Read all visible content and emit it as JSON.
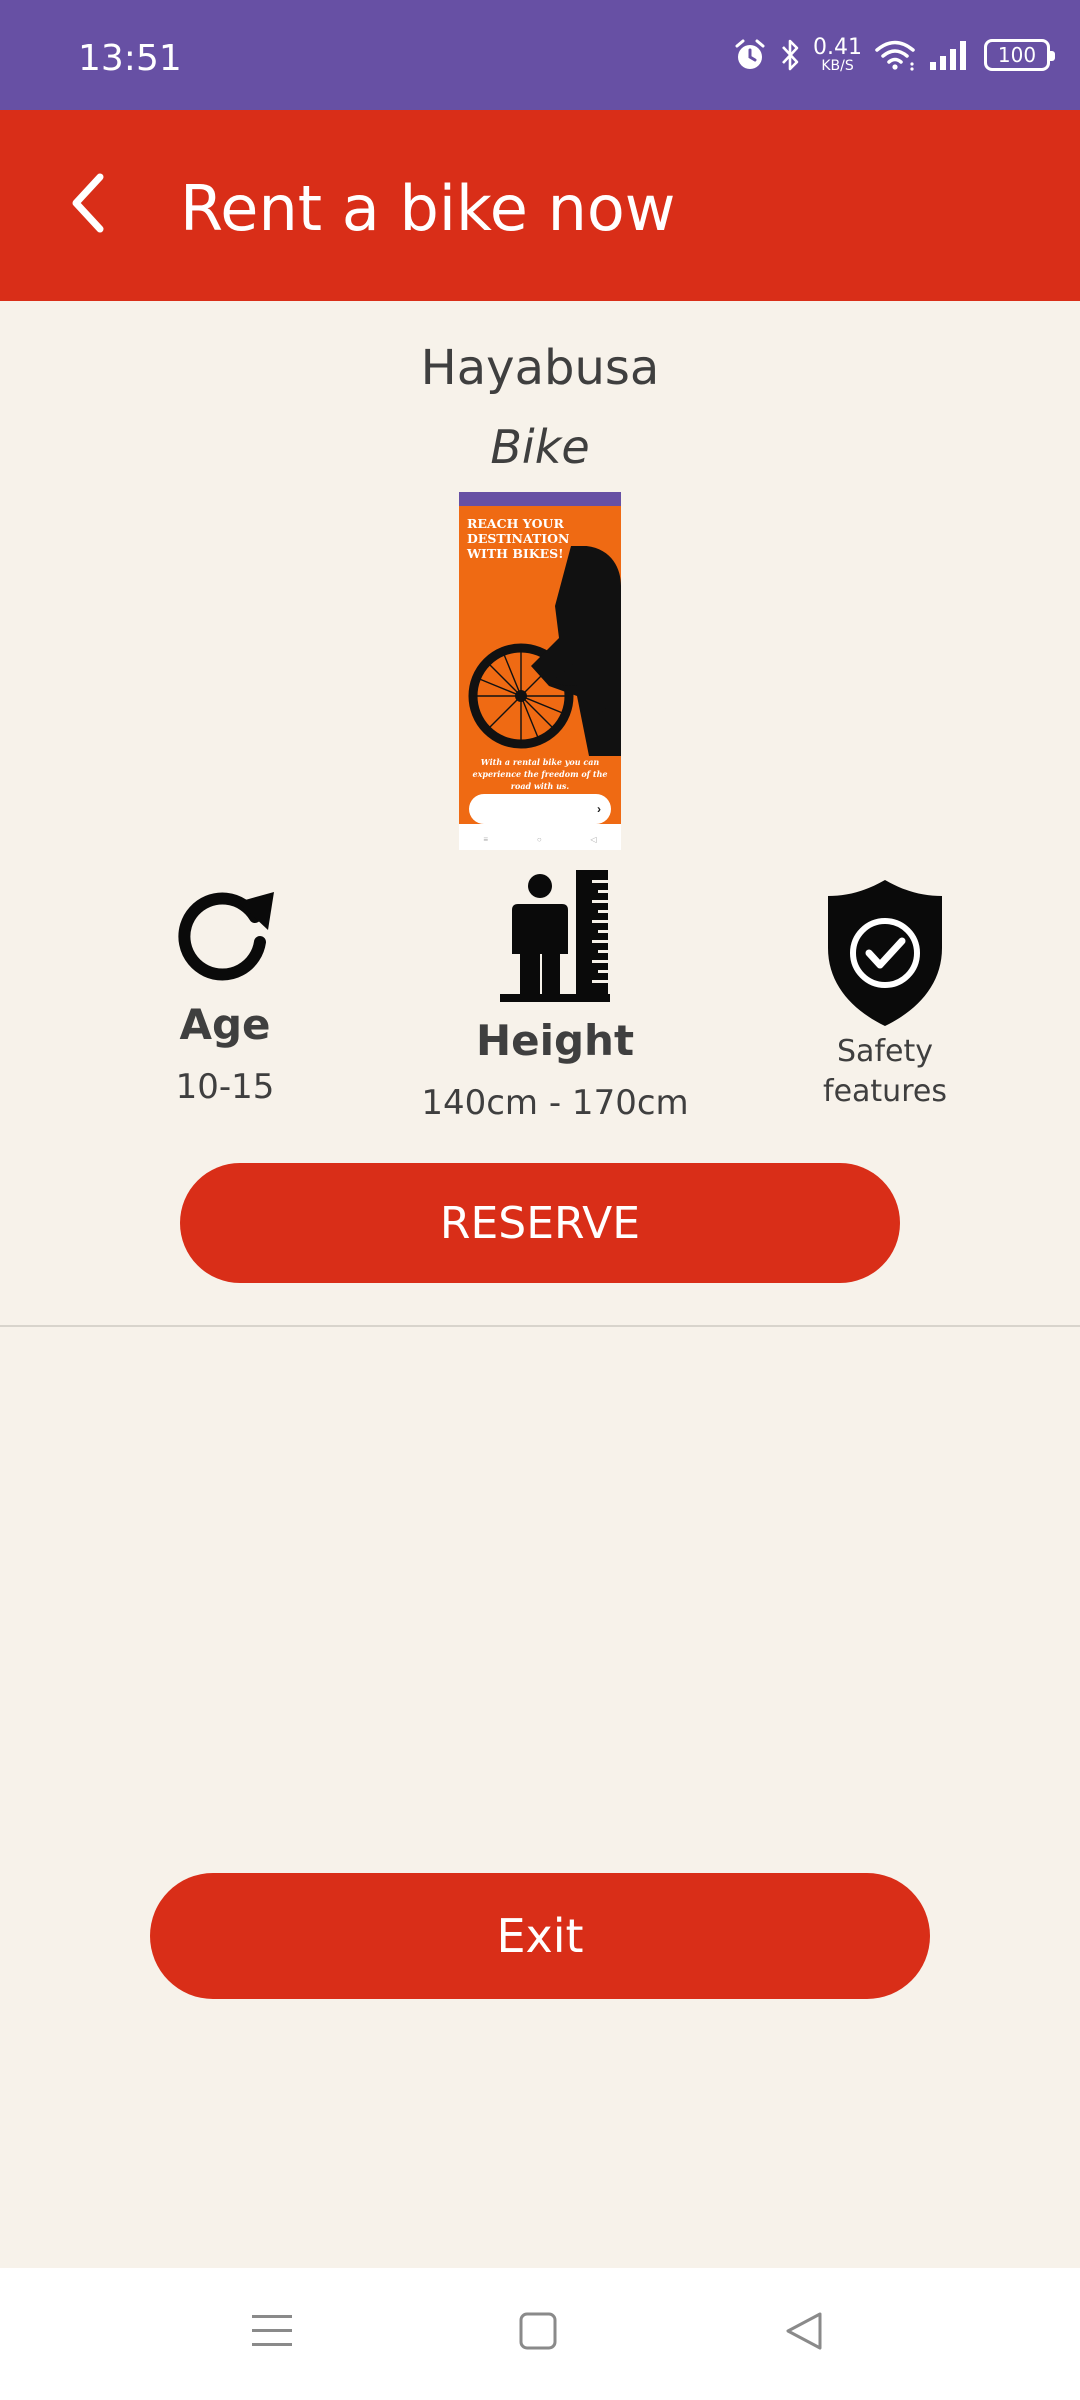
{
  "status_bar": {
    "time": "13:51",
    "net_speed_value": "0.41",
    "net_speed_unit": "KB/S",
    "battery": "100",
    "icons": [
      "alarm-icon",
      "bluetooth-icon",
      "wifi-icon",
      "signal-icon",
      "battery-icon"
    ]
  },
  "app_bar": {
    "title": "Rent a bike now",
    "back_icon": "chevron-left-icon"
  },
  "product": {
    "name": "Hayabusa",
    "type": "Bike"
  },
  "preview": {
    "headline": "REACH YOUR DESTINATION WITH BIKES!",
    "body": "With a rental bike you can experience the freedom of the road with us."
  },
  "features": {
    "age": {
      "label": "Age",
      "value": "10-15",
      "icon": "refresh-icon"
    },
    "height": {
      "label": "Height",
      "value": "140cm - 170cm",
      "icon": "height-measure-icon"
    },
    "safety": {
      "label": "Safety features",
      "icon": "shield-check-icon"
    }
  },
  "actions": {
    "reserve_label": "RESERVE",
    "exit_label": "Exit"
  },
  "colors": {
    "status_bar": "#6750a4",
    "primary": "#d92e18",
    "background": "#f7f2ea"
  },
  "nav_bar": {
    "icons": [
      "menu-icon",
      "home-square-icon",
      "back-triangle-icon"
    ]
  }
}
